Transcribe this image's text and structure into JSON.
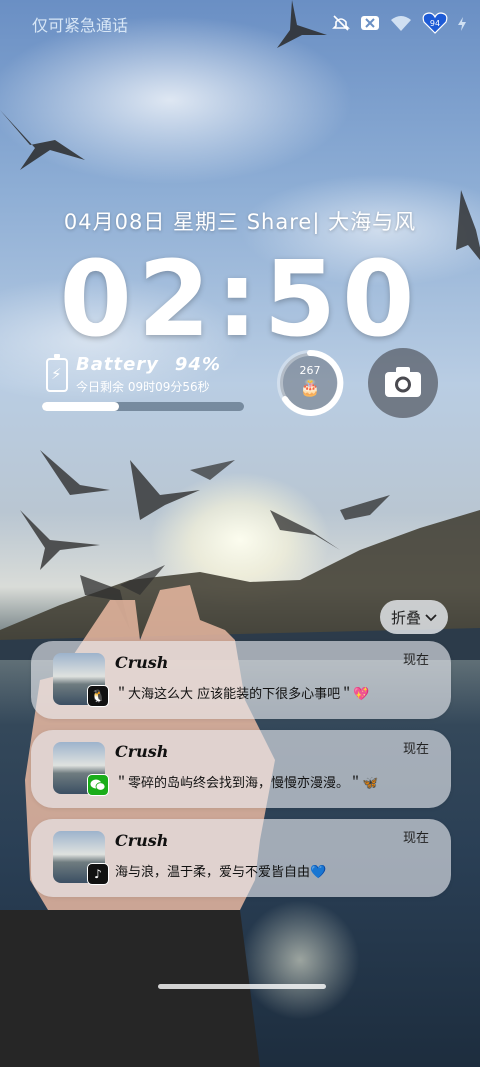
{
  "status_bar": {
    "carrier_text": "仅可紧急通话",
    "icons": [
      "mute-icon",
      "no-sim-icon",
      "wifi-icon",
      "heart-battery-icon",
      "charging-icon"
    ]
  },
  "lockscreen": {
    "date_line": "04月08日  星期三  Share|  大海与风",
    "time": "02:50"
  },
  "battery_widget": {
    "label": "Battery",
    "percent_text": "94%",
    "percent": 0.94,
    "remaining_label": "今日剩余",
    "remaining_time": "09时09分56秒",
    "day_progress": 0.38
  },
  "ring_widget": {
    "count": "267",
    "icon": "cake-icon"
  },
  "camera_button": {
    "icon": "camera-icon"
  },
  "fold_button": {
    "label": "折叠"
  },
  "notifications": [
    {
      "title": "Crush",
      "time": "现在",
      "body": "＂大海这么大 应该能装的下很多心事吧＂💖",
      "app": "qq-icon",
      "app_color": "#111111"
    },
    {
      "title": "Crush",
      "time": "现在",
      "body": "＂零碎的岛屿终会找到海，慢慢亦漫漫。＂🦋",
      "app": "wechat-icon",
      "app_color": "#1aad19"
    },
    {
      "title": "Crush",
      "time": "现在",
      "body": "海与浪，温于柔，爱与不爱皆自由💙",
      "app": "tiktok-icon",
      "app_color": "#111111"
    }
  ]
}
